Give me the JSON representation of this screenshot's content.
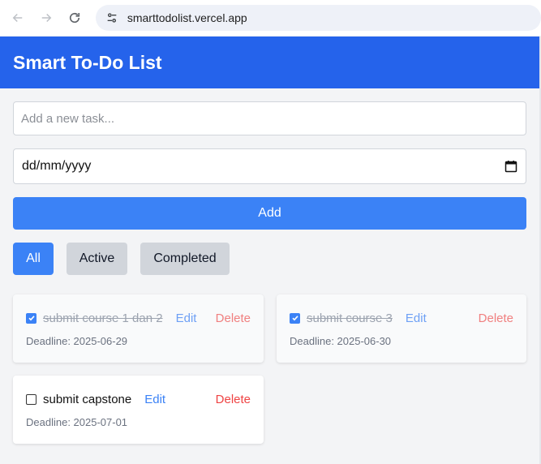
{
  "browser": {
    "url": "smarttodolist.vercel.app",
    "icons": {
      "back": "arrow-left-icon",
      "forward": "arrow-right-icon",
      "reload": "reload-icon",
      "site_info": "tune-icon"
    }
  },
  "app": {
    "title": "Smart To-Do List",
    "header_color": "#2563eb",
    "accent_color": "#3b82f6"
  },
  "form": {
    "task_placeholder": "Add a new task...",
    "task_value": "",
    "date_value": "dd/mm/yyyy",
    "add_label": "Add"
  },
  "filters": [
    {
      "label": "All",
      "selected": true
    },
    {
      "label": "Active",
      "selected": false
    },
    {
      "label": "Completed",
      "selected": false
    }
  ],
  "tasks": [
    {
      "title": "submit course 1 dan 2",
      "completed": true,
      "deadline": "Deadline: 2025-06-29",
      "edit_label": "Edit",
      "delete_label": "Delete"
    },
    {
      "title": "submit course 3",
      "completed": true,
      "deadline": "Deadline: 2025-06-30",
      "edit_label": "Edit",
      "delete_label": "Delete"
    },
    {
      "title": "submit capstone",
      "completed": false,
      "deadline": "Deadline: 2025-07-01",
      "edit_label": "Edit",
      "delete_label": "Delete"
    }
  ]
}
